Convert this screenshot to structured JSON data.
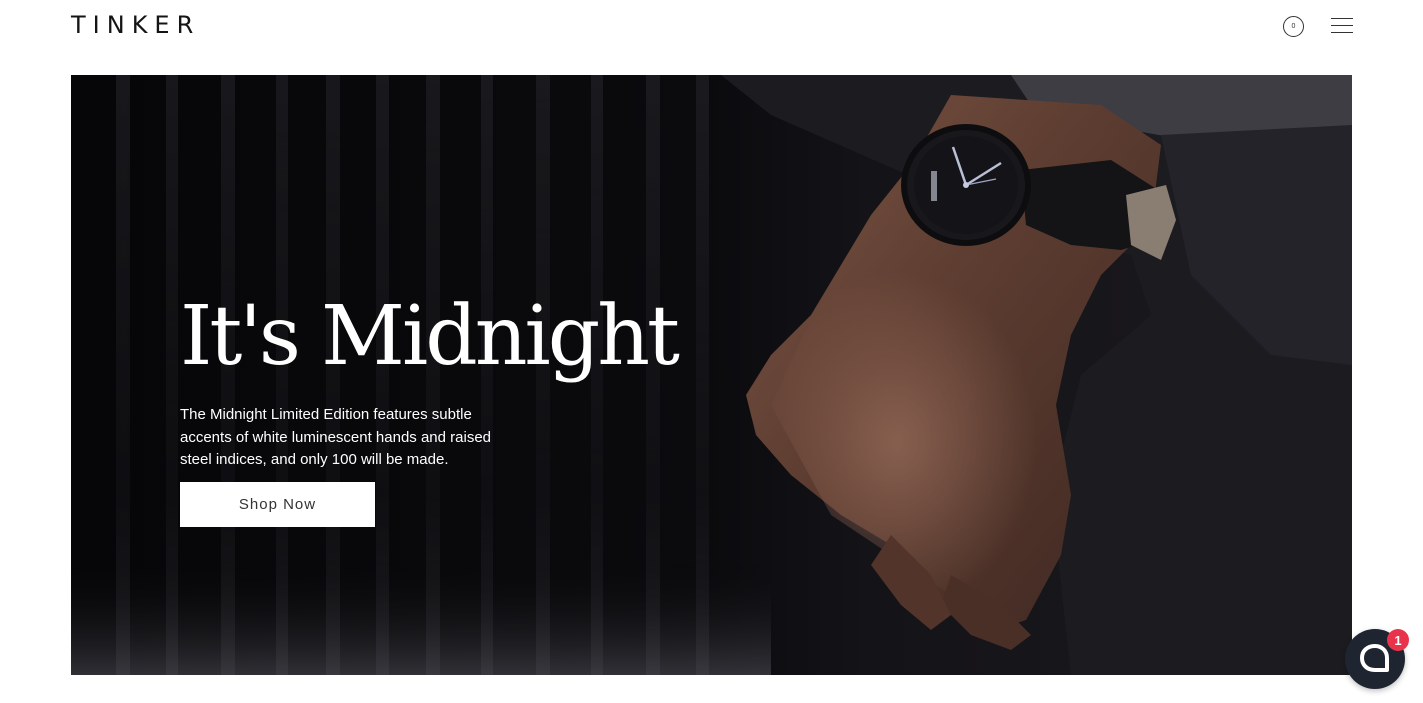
{
  "header": {
    "logo": "TINKER",
    "cart_count": "0",
    "cart_icon": "cart-circle-icon",
    "menu_icon": "hamburger-menu-icon"
  },
  "hero": {
    "title": "It's Midnight",
    "description": "The Midnight Limited Edition features subtle accents of white luminescent hands and raised steel indices, and only 100 will be made.",
    "cta_label": "Shop Now",
    "image_description_icon": "watch-on-wrist-photo"
  },
  "chat": {
    "icon": "chat-bubble-icon",
    "badge_count": "1",
    "badge_color": "#e8334a"
  },
  "colors": {
    "hero_background": "#0a0a0c",
    "text_primary": "#141414",
    "button_background": "#ffffff"
  }
}
